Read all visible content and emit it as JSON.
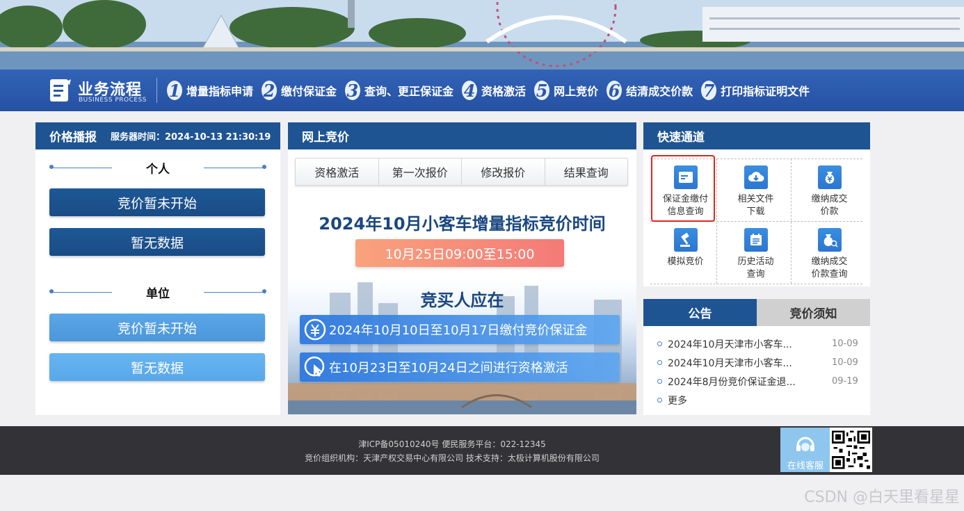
{
  "process": {
    "title": "业务流程",
    "subtitle": "BUSINESS PROCESS",
    "steps": [
      {
        "num": "1",
        "label": "增量指标申请"
      },
      {
        "num": "2",
        "label": "缴付保证金"
      },
      {
        "num": "3",
        "label": "查询、更正保证金"
      },
      {
        "num": "4",
        "label": "资格激活"
      },
      {
        "num": "5",
        "label": "网上竞价"
      },
      {
        "num": "6",
        "label": "结清成交价款"
      },
      {
        "num": "7",
        "label": "打印指标证明文件"
      }
    ]
  },
  "price": {
    "header": "价格播报",
    "server_time": "服务器时间：2024-10-13 21:30:19",
    "personal_label": "个人",
    "personal_status": "竞价暂未开始",
    "personal_data": "暂无数据",
    "unit_label": "单位",
    "unit_status": "竞价暂未开始",
    "unit_data": "暂无数据"
  },
  "bidding": {
    "header": "网上竞价",
    "tabs": [
      "资格激活",
      "第一次报价",
      "修改报价",
      "结果查询"
    ],
    "title": "2024年10月小客车增量指标竞价时间",
    "time": "10月25日09:00至15:00",
    "subtitle": "竞买人应在",
    "info1": "2024年10月10日至10月17日缴付竞价保证金",
    "info2": "在10月23日至10月24日之间进行资格激活"
  },
  "quick": {
    "header": "快速通道",
    "items": [
      {
        "line1": "保证金缴付",
        "line2": "信息查询",
        "icon": "card-icon"
      },
      {
        "line1": "相关文件",
        "line2": "下载",
        "icon": "cloud-download-icon"
      },
      {
        "line1": "缴纳成交",
        "line2": "价款",
        "icon": "money-bag-icon"
      },
      {
        "line1": "模拟竞价",
        "line2": "",
        "icon": "gavel-icon"
      },
      {
        "line1": "历史活动",
        "line2": "查询",
        "icon": "calendar-icon"
      },
      {
        "line1": "缴纳成交",
        "line2": "价款查询",
        "icon": "money-search-icon"
      }
    ]
  },
  "notice": {
    "tab_active": "公告",
    "tab_inactive": "竞价须知",
    "items": [
      {
        "text": "2024年10月天津市小客车...",
        "date": "10-09"
      },
      {
        "text": "2024年10月天津市小客车...",
        "date": "10-09"
      },
      {
        "text": "2024年8月份竞价保证金退...",
        "date": "09-19"
      },
      {
        "text": "更多",
        "date": ""
      }
    ]
  },
  "footer": {
    "line1": "津ICP备05010240号    便民服务平台：022-12345",
    "line2": "竞价组织机构：天津产权交易中心有限公司    技术支持：太极计算机股份有限公司",
    "service_label": "在线客服"
  },
  "watermark": "CSDN @白天里看星星",
  "colors": {
    "primary": "#1f5493",
    "accent_red": "#e0261f",
    "pill": "#f47a78"
  }
}
